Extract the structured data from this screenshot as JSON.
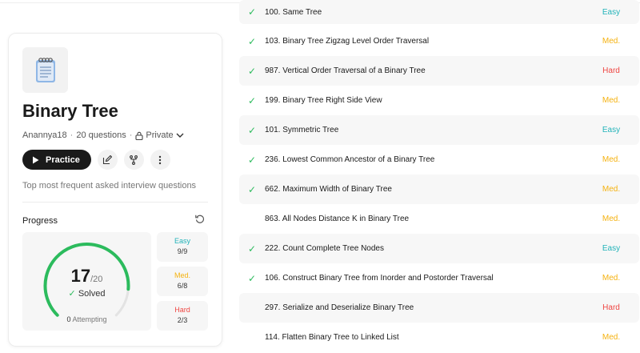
{
  "colors": {
    "easy": "#22b3b9",
    "medium": "#f5b210",
    "hard": "#ef4743",
    "check": "#2cbb5d"
  },
  "list_info": {
    "title": "Binary Tree",
    "author": "Anannya18",
    "question_count": "20 questions",
    "visibility": "Private",
    "practice_label": "Practice",
    "description": "Top most frequent asked interview questions"
  },
  "progress": {
    "label": "Progress",
    "solved_count": "17",
    "total": "/20",
    "solved_label": "Solved",
    "solved_fraction": 0.85,
    "attempting_count": "0",
    "attempting_label": "Attempting",
    "easy": {
      "label": "Easy",
      "value": "9/9"
    },
    "medium": {
      "label": "Med.",
      "value": "6/8"
    },
    "hard": {
      "label": "Hard",
      "value": "2/3"
    }
  },
  "problems": [
    {
      "title": "100. Same Tree",
      "difficulty": "Easy",
      "solved": true
    },
    {
      "title": "103. Binary Tree Zigzag Level Order Traversal",
      "difficulty": "Med.",
      "solved": true
    },
    {
      "title": "987. Vertical Order Traversal of a Binary Tree",
      "difficulty": "Hard",
      "solved": true
    },
    {
      "title": "199. Binary Tree Right Side View",
      "difficulty": "Med.",
      "solved": true
    },
    {
      "title": "101. Symmetric Tree",
      "difficulty": "Easy",
      "solved": true
    },
    {
      "title": "236. Lowest Common Ancestor of a Binary Tree",
      "difficulty": "Med.",
      "solved": true
    },
    {
      "title": "662. Maximum Width of Binary Tree",
      "difficulty": "Med.",
      "solved": true
    },
    {
      "title": "863. All Nodes Distance K in Binary Tree",
      "difficulty": "Med.",
      "solved": false
    },
    {
      "title": "222. Count Complete Tree Nodes",
      "difficulty": "Easy",
      "solved": true
    },
    {
      "title": "106. Construct Binary Tree from Inorder and Postorder Traversal",
      "difficulty": "Med.",
      "solved": true
    },
    {
      "title": "297. Serialize and Deserialize Binary Tree",
      "difficulty": "Hard",
      "solved": false
    },
    {
      "title": "114. Flatten Binary Tree to Linked List",
      "difficulty": "Med.",
      "solved": false
    }
  ]
}
